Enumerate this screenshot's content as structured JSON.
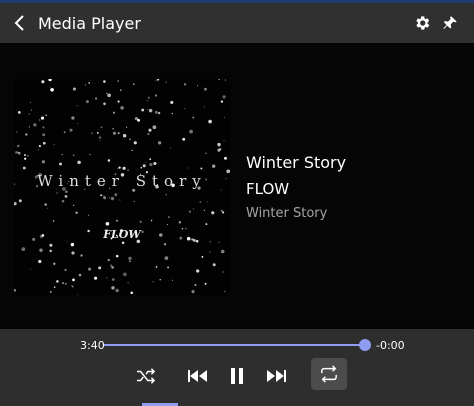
{
  "window": {
    "title": "Media Player"
  },
  "album_art": {
    "title_text": "Winter Story",
    "band_text": "FLOW"
  },
  "now_playing": {
    "song": "Winter Story",
    "artist": "FLOW",
    "album": "Winter Story"
  },
  "playback": {
    "elapsed": "3:40",
    "remaining": "-0:00",
    "progress": 0.98,
    "is_playing": true,
    "repeat_active": true
  },
  "icons": {
    "back": "chevron-left-icon",
    "settings": "gear-icon",
    "pin": "pin-icon",
    "shuffle": "shuffle-icon",
    "previous": "skip-previous-icon",
    "pause": "pause-icon",
    "next": "skip-next-icon",
    "repeat": "repeat-icon"
  },
  "colors": {
    "accent": "#8f9cf0",
    "titlebar": "#303030",
    "controls_bg": "#2e2e2e",
    "content_bg": "#050505"
  }
}
